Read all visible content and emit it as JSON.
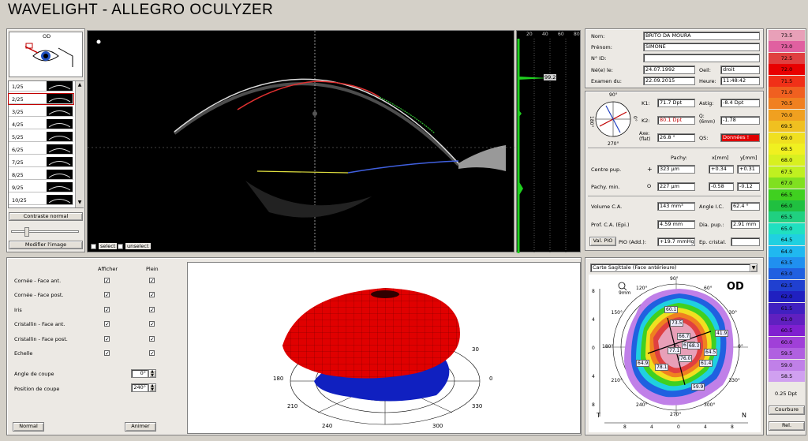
{
  "app": {
    "title": "WAVELIGHT  -  ALLEGRO OCULYZER"
  },
  "eye": {
    "label": "OD"
  },
  "slices": {
    "items": [
      "1/25",
      "2/25",
      "3/25",
      "4/25",
      "5/25",
      "6/25",
      "7/25",
      "8/25",
      "9/25",
      "10/25"
    ],
    "selected_index": 1,
    "contrast_button": "Contraste normal",
    "modify_button": "Modifier l'image"
  },
  "scan": {
    "select_label": "select",
    "unselect_label": "unselect",
    "histo_ticks": [
      "20",
      "40",
      "60",
      "80"
    ],
    "histo_value": "99.2"
  },
  "patient": {
    "nom_label": "Nom:",
    "nom": "BRITO DA MOURA",
    "prenom_label": "Prénom:",
    "prenom": "SIMONE",
    "id_label": "N° ID:",
    "id": "",
    "dob_label": "Né(e) le:",
    "dob": "24.07.1992",
    "oeil_label": "Oeil:",
    "oeil": "droit",
    "exam_label": "Examen du:",
    "exam": "22.09.2015",
    "heure_label": "Heure:",
    "heure": "11:48:42"
  },
  "kerato": {
    "deg_top": "90°",
    "deg_left": "180°",
    "deg_right": "0°",
    "deg_bottom": "270°",
    "k1_label": "K1:",
    "k1": "71.7 Dpt",
    "k2_label": "K2:",
    "k2": "80.1 Dpt",
    "axe_label": "Axe: (flat)",
    "axe": "26.8 °",
    "astig_label": "Astig:",
    "astig": "-8.4 Dpt",
    "q_label": "Q: (6mm)",
    "q": "-1.78",
    "qs_label": "QS:",
    "qs": "Données !"
  },
  "pachy": {
    "header": "Pachy:",
    "x_header": "x[mm]",
    "y_header": "y[mm]",
    "centre_label": "Centre pup.",
    "centre_symbol": "+",
    "centre": "323 µm",
    "centre_x": "+0.34",
    "centre_y": "+0.31",
    "min_label": "Pachy. min.",
    "min_symbol": "O",
    "min": "227 µm",
    "min_x": "-0.58",
    "min_y": "-0.12"
  },
  "chamber": {
    "vol_label": "Volume C.A.",
    "vol": "143 mm³",
    "angle_label": "Angle I.C.",
    "angle": "62.4 °",
    "prof_label": "Prof. C.A. (Epi.)",
    "prof": "4.59 mm",
    "dia_label": "Dia. pup.:",
    "dia": "2.91 mm",
    "val_pio_button": "Val. PIO",
    "pio_label": "PIO (Add.):",
    "pio": "+19.7 mmHg",
    "ep_label": "Ep. cristal.",
    "ep": ""
  },
  "layers": {
    "afficher_header": "Afficher",
    "plein_header": "Plein",
    "rows": [
      {
        "label": "Cornée - Face ant."
      },
      {
        "label": "Cornée - Face post."
      },
      {
        "label": "Iris"
      },
      {
        "label": "Cristallin - Face ant."
      },
      {
        "label": "Cristallin - Face post."
      },
      {
        "label": "Echelle"
      }
    ],
    "check": "✓",
    "angle_label": "Angle de coupe",
    "angle": "0°",
    "position_label": "Position de coupe",
    "position": "240°",
    "normal_button": "Normal",
    "animer_button": "Animer"
  },
  "model3d": {
    "labels": [
      "30",
      "0",
      "330",
      "300",
      "240",
      "210",
      "180"
    ]
  },
  "map": {
    "select": "Carte Sagittale (Face antérieure)",
    "od": "OD",
    "size": "9mm",
    "left_T": "T",
    "right_N": "N",
    "angles": [
      "90°",
      "60°",
      "30°",
      "0°",
      "330°",
      "300°",
      "270°",
      "240°",
      "210°",
      "180°",
      "150°",
      "120°"
    ],
    "axis_ticks": [
      "8",
      "4",
      "0",
      "4",
      "8"
    ],
    "values": [
      "60.1",
      "73.5",
      "66.7",
      "61.9",
      "41.9",
      "64.9",
      "77.1",
      "76.0",
      "68.3",
      "64.5",
      "78.1",
      "61.4",
      "59.9"
    ]
  },
  "scale": {
    "values": [
      "73.5",
      "73.0",
      "72.5",
      "72.0",
      "71.5",
      "71.0",
      "70.5",
      "70.0",
      "69.5",
      "69.0",
      "68.5",
      "68.0",
      "67.5",
      "67.0",
      "66.5",
      "66.0",
      "65.5",
      "65.0",
      "64.5",
      "64.0",
      "63.5",
      "63.0",
      "62.5",
      "62.0",
      "61.5",
      "61.0",
      "60.5",
      "60.0",
      "59.5",
      "59.0",
      "58.5"
    ],
    "colors": [
      "#e8a0b8",
      "#e060a0",
      "#e04040",
      "#e80000",
      "#f03018",
      "#f06020",
      "#f08020",
      "#f0a020",
      "#f0c020",
      "#f0e020",
      "#f0f020",
      "#d8f020",
      "#c0f020",
      "#80e020",
      "#40d020",
      "#20c040",
      "#20d080",
      "#20e0c0",
      "#20d0e0",
      "#20b8f0",
      "#2090f0",
      "#2060e0",
      "#2040d0",
      "#2020c0",
      "#4020c0",
      "#6020c0",
      "#8020d0",
      "#a040d8",
      "#b060e0",
      "#c080e8",
      "#d0a0f0"
    ],
    "step": "0.25 Dpt",
    "courbure_button": "Courbure",
    "rel_button": "Rel."
  }
}
